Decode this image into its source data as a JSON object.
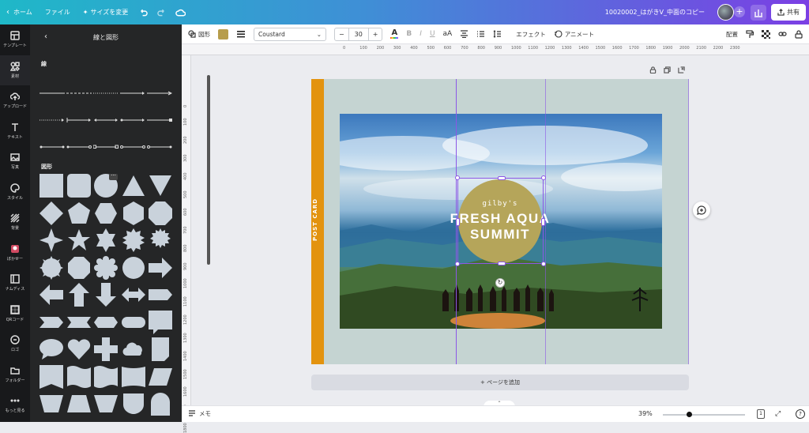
{
  "topbar": {
    "home": "ホーム",
    "file": "ファイル",
    "resize": "サイズを変更",
    "doc_title": "10020002_はがきV_中面のコピー",
    "share": "共有"
  },
  "rail": [
    {
      "label": "テンプレート",
      "icon": "layout-icon"
    },
    {
      "label": "素材",
      "icon": "elements-icon"
    },
    {
      "label": "アップロード",
      "icon": "upload-icon"
    },
    {
      "label": "テキスト",
      "icon": "text-icon"
    },
    {
      "label": "写真",
      "icon": "photo-icon"
    },
    {
      "label": "スタイル",
      "icon": "palette-icon"
    },
    {
      "label": "背景",
      "icon": "background-icon"
    },
    {
      "label": "ぼかせー",
      "icon": "app-icon"
    },
    {
      "label": "ナムディス",
      "icon": "app2-icon"
    },
    {
      "label": "QRコード",
      "icon": "qr-icon"
    },
    {
      "label": "ロゴ",
      "icon": "logo-icon"
    },
    {
      "label": "フォルダー",
      "icon": "folder-icon"
    },
    {
      "label": "もっと見る",
      "icon": "more-icon"
    }
  ],
  "panel": {
    "title": "線と図形",
    "lines_label": "線",
    "shapes_label": "図形"
  },
  "toolbar": {
    "shape_label": "図形",
    "text_color": "#b79d4b",
    "font": "Coustard",
    "size": "30",
    "minus": "−",
    "plus": "+",
    "effects": "エフェクト",
    "animate": "アニメート",
    "position": "配置"
  },
  "ruler_top": [
    "0",
    "100",
    "200",
    "300",
    "400",
    "500",
    "600",
    "700",
    "800",
    "900",
    "1000",
    "1100",
    "1200",
    "1300",
    "1400",
    "1500",
    "1600",
    "1700",
    "1800",
    "1900",
    "2000",
    "2100",
    "2200",
    "2300"
  ],
  "ruler_left": [
    "0",
    "100",
    "200",
    "300",
    "400",
    "500",
    "600",
    "700",
    "800",
    "900",
    "1000",
    "1100",
    "1200",
    "1300",
    "1400",
    "1500",
    "1600",
    "1700",
    "1800"
  ],
  "card": {
    "stripe_text": "POST CARD",
    "stripe_color": "#e3930f",
    "background": "#c5d4d2",
    "logo_brand": "gilby's",
    "logo_line1": "FRESH AQUA",
    "logo_line2": "SUMMIT",
    "logo_color": "#b5a55a"
  },
  "add_page": "+ ページを追加",
  "bottom": {
    "notes": "メモ",
    "zoom": "39%",
    "zoom_level_fraction": 0.32,
    "page_count": "1"
  }
}
